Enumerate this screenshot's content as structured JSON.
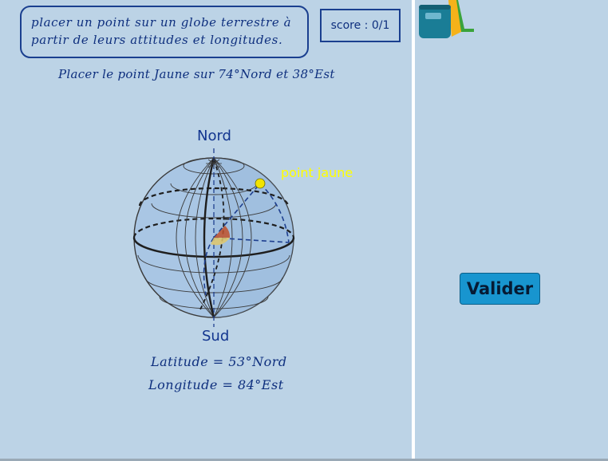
{
  "instructions": {
    "line1": "placer un point sur un globe terrestre à",
    "line2": "partir de leurs attitudes et longitudes."
  },
  "score": {
    "label": "score : 0/1"
  },
  "task": {
    "text": "Placer le point Jaune sur 74°Nord et 38°Est"
  },
  "globe": {
    "north_label": "Nord",
    "south_label": "Sud",
    "point_label": "point jaune",
    "point_color": "#ffff00",
    "globe_color": "#a9c6e4",
    "sector_color": "#c0502b"
  },
  "readout": {
    "latitude": "Latitude = 53°Nord",
    "longitude": "Longitude = 84°Est"
  },
  "actions": {
    "validate_label": "Valider"
  },
  "toolbar": {
    "backpack_icon": "backpack-icon"
  }
}
